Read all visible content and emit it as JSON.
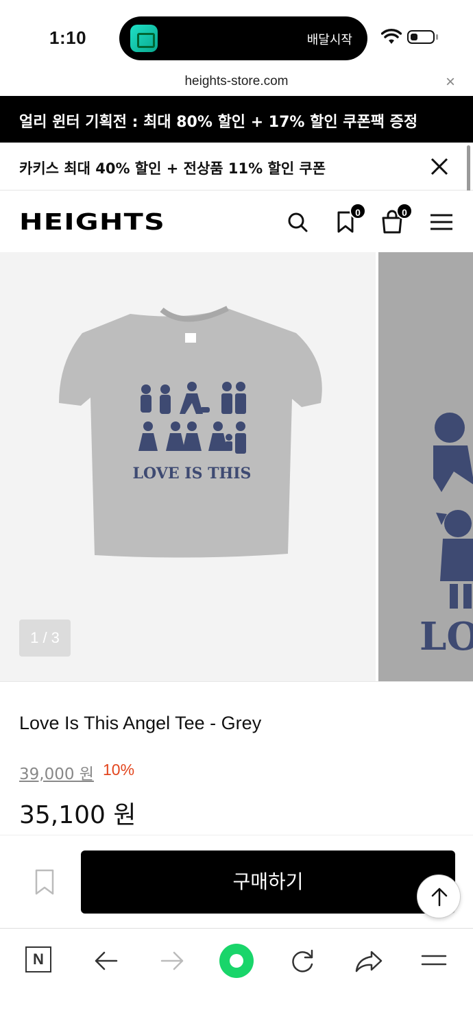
{
  "status_bar": {
    "time": "1:10",
    "island_text": "배달시작"
  },
  "browser": {
    "url": "heights-store.com",
    "close_glyph": "×"
  },
  "promos": {
    "top_banner": "얼리 윈터 기획전 : 최대 80% 할인 + 17% 할인 쿠폰팩 증정",
    "second_banner": "카키스 최대 40% 할인 + 전상품 11% 할인 쿠폰"
  },
  "header": {
    "logo": "HEIGHTS",
    "wishlist_count": "0",
    "cart_count": "0"
  },
  "gallery": {
    "pager": "1 / 3",
    "shirt_print_text": "LOVE IS THIS",
    "next_slide_text": "LO"
  },
  "product": {
    "name": "Love Is This Angel Tee - Grey",
    "original_price": "39,000 원",
    "discount": "10%",
    "price": "35,100 원"
  },
  "actions": {
    "buy_label": "구매하기"
  },
  "toolbar": {
    "n_label": "N"
  },
  "colors": {
    "accent": "#19d56a",
    "discount": "#e2451d",
    "print_navy": "#3e4a72"
  }
}
